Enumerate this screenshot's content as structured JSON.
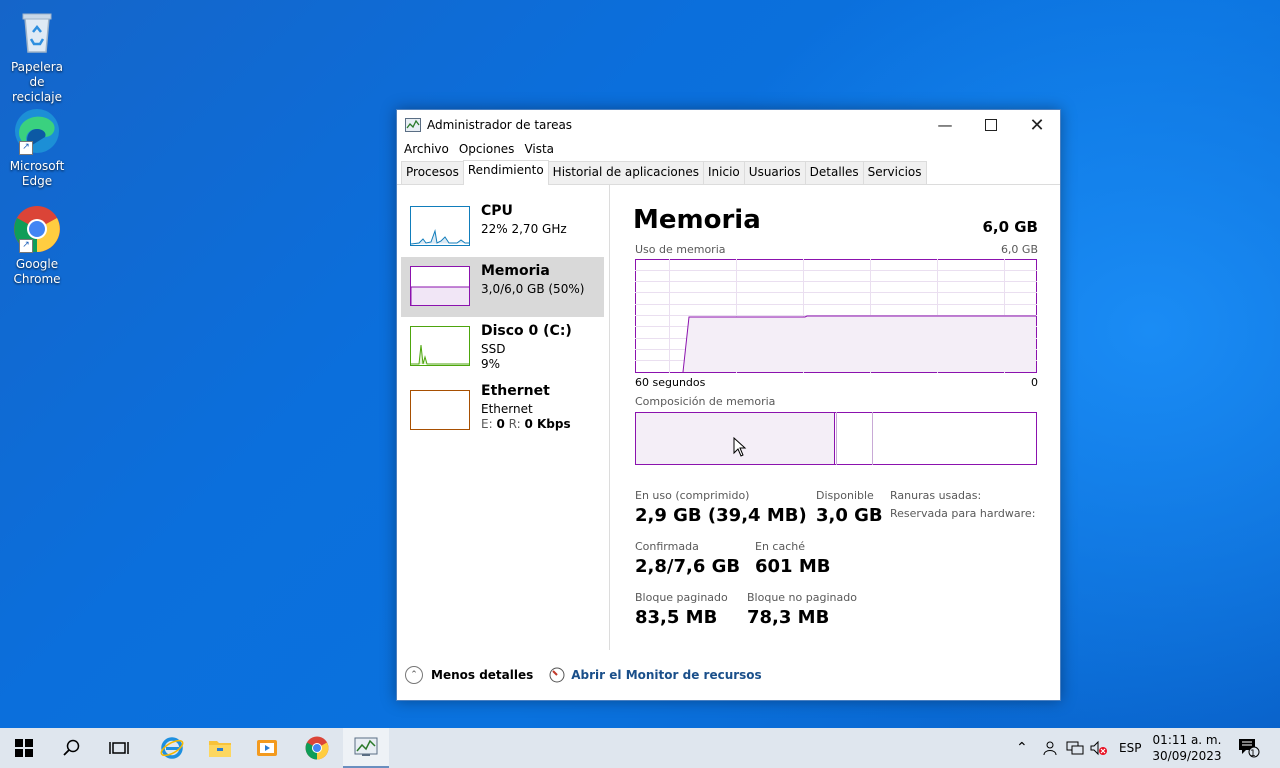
{
  "desktop": {
    "icons": [
      {
        "label_1": "Papelera de",
        "label_2": "reciclaje"
      },
      {
        "label_1": "Microsoft",
        "label_2": "Edge"
      },
      {
        "label_1": "Google",
        "label_2": "Chrome"
      }
    ]
  },
  "window": {
    "title": "Administrador de tareas",
    "menu": [
      "Archivo",
      "Opciones",
      "Vista"
    ],
    "tabs": [
      "Procesos",
      "Rendimiento",
      "Historial de aplicaciones",
      "Inicio",
      "Usuarios",
      "Detalles",
      "Servicios"
    ],
    "active_tab": "Rendimiento"
  },
  "sidebar": {
    "items": [
      {
        "name": "CPU",
        "line1": "22%  2,70 GHz",
        "line2": "",
        "color": "#117dbb"
      },
      {
        "name": "Memoria",
        "line1": "3,0/6,0 GB (50%)",
        "line2": "",
        "color": "#8b12ae"
      },
      {
        "name": "Disco 0 (C:)",
        "line1": "SSD",
        "line2": "9%",
        "color": "#4da60c"
      },
      {
        "name": "Ethernet",
        "line1": "Ethernet",
        "line2_prefix_e": "E:",
        "line2_e_val": "0",
        "line2_prefix_r": "R:",
        "line2_r_val": "0 Kbps",
        "color": "#a74f01"
      }
    ]
  },
  "memory": {
    "title": "Memoria",
    "total": "6,0 GB",
    "usage_label": "Uso de memoria",
    "usage_max": "6,0 GB",
    "time_left": "60 segundos",
    "time_right": "0",
    "composition_label": "Composición de memoria",
    "stats": {
      "in_use_label": "En uso (comprimido)",
      "in_use_value": "2,9 GB (39,4 MB)",
      "available_label": "Disponible",
      "available_value": "3,0 GB",
      "slots_label": "Ranuras usadas:",
      "reserved_label": "Reservada para hardware:",
      "committed_label": "Confirmada",
      "committed_value": "2,8/7,6 GB",
      "cached_label": "En caché",
      "cached_value": "601 MB",
      "paged_label": "Bloque paginado",
      "paged_value": "83,5 MB",
      "nonpaged_label": "Bloque no paginado",
      "nonpaged_value": "78,3 MB"
    }
  },
  "footer": {
    "fewer_details": "Menos detalles",
    "resource_monitor": "Abrir el Monitor de recursos"
  },
  "taskbar": {
    "language": "ESP",
    "time": "01:11 a. m.",
    "date": "30/09/2023",
    "notification_count": "1"
  }
}
